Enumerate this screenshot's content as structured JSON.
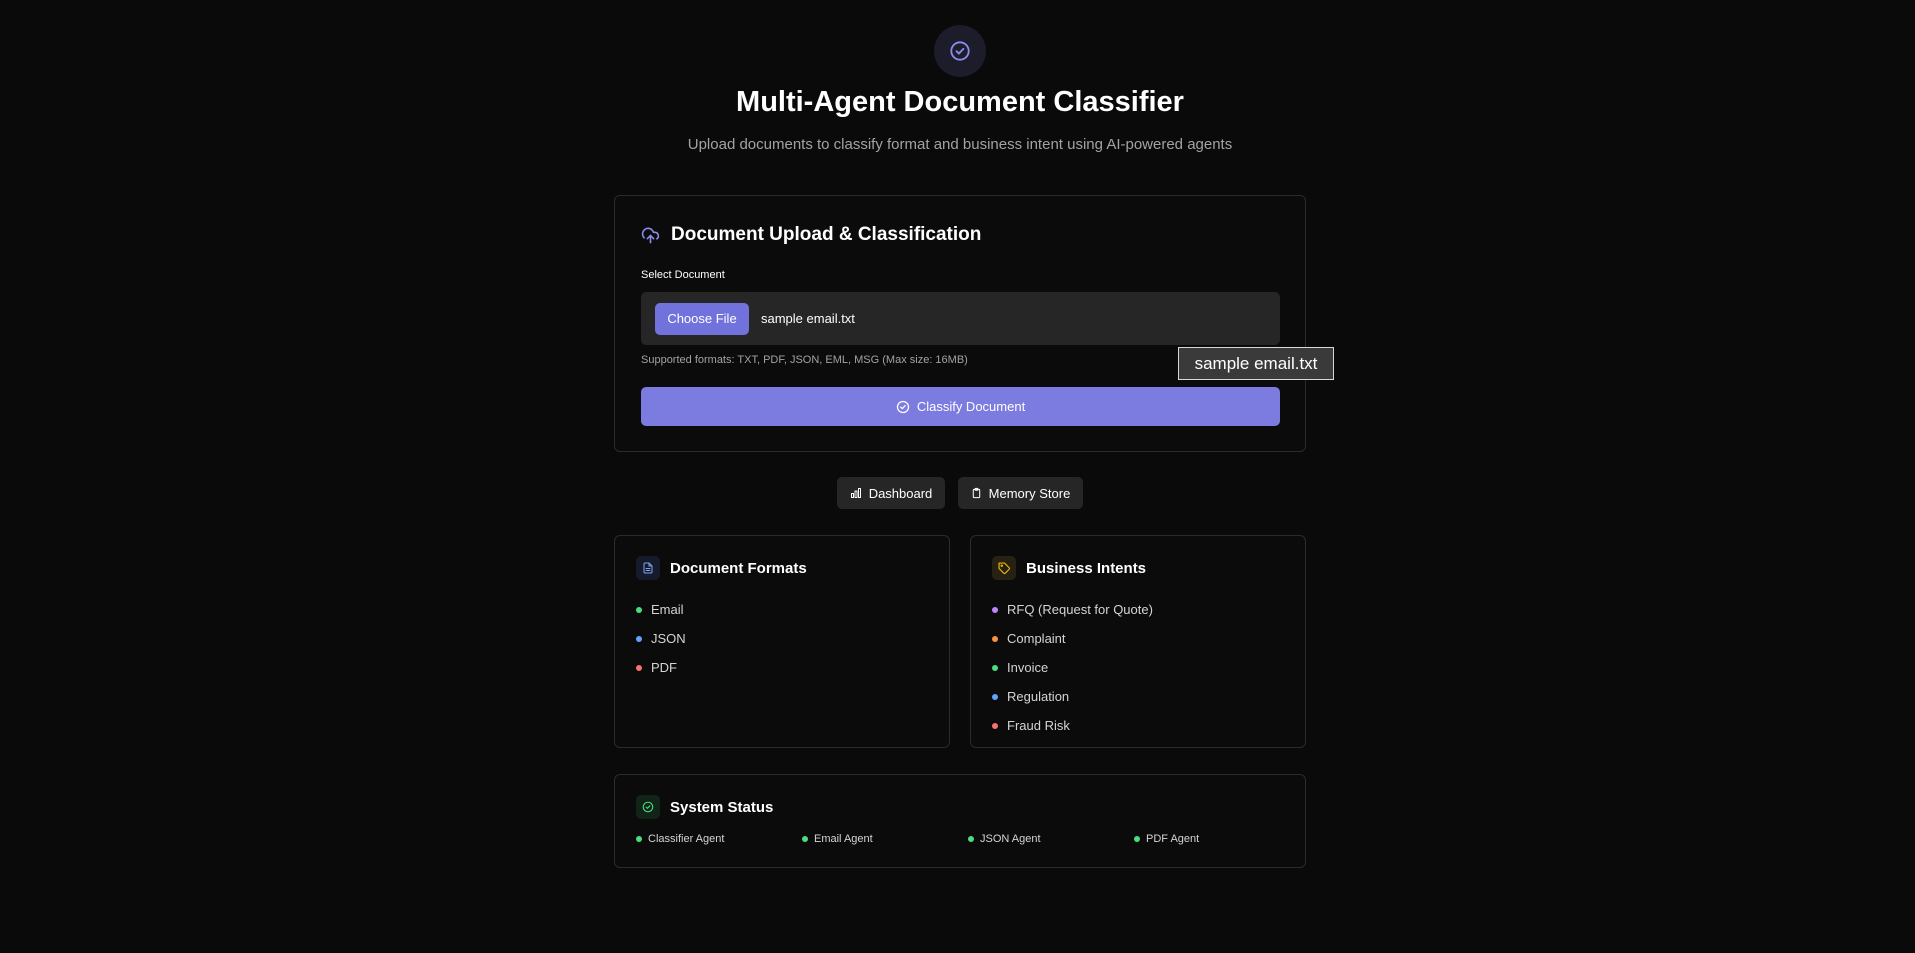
{
  "header": {
    "title": "Multi-Agent Document Classifier",
    "subtitle": "Upload documents to classify format and business intent using AI-powered agents",
    "logo_icon": "check-circle-icon",
    "accent": "#7b7be0"
  },
  "upload": {
    "title": "Document Upload & Classification",
    "icon": "upload-cloud-icon",
    "field_label": "Select Document",
    "choose_label": "Choose File",
    "file_name": "sample email.txt",
    "formats_note": "Supported formats: TXT, PDF, JSON, EML, MSG (Max size: 16MB)",
    "classify_label": "Classify Document",
    "tooltip": "sample email.txt"
  },
  "nav": {
    "dashboard_label": "Dashboard",
    "memory_label": "Memory Store"
  },
  "formats": {
    "title": "Document Formats",
    "items": [
      {
        "label": "Email",
        "color": "#4ade80"
      },
      {
        "label": "JSON",
        "color": "#60a5fa"
      },
      {
        "label": "PDF",
        "color": "#f87171"
      }
    ]
  },
  "intents": {
    "title": "Business Intents",
    "items": [
      {
        "label": "RFQ (Request for Quote)",
        "color": "#c084fc"
      },
      {
        "label": "Complaint",
        "color": "#fb923c"
      },
      {
        "label": "Invoice",
        "color": "#4ade80"
      },
      {
        "label": "Regulation",
        "color": "#60a5fa"
      },
      {
        "label": "Fraud Risk",
        "color": "#f87171"
      }
    ]
  },
  "status": {
    "title": "System Status",
    "agents": [
      {
        "label": "Classifier Agent",
        "color": "#4ade80"
      },
      {
        "label": "Email Agent",
        "color": "#4ade80"
      },
      {
        "label": "JSON Agent",
        "color": "#4ade80"
      },
      {
        "label": "PDF Agent",
        "color": "#4ade80"
      }
    ]
  }
}
